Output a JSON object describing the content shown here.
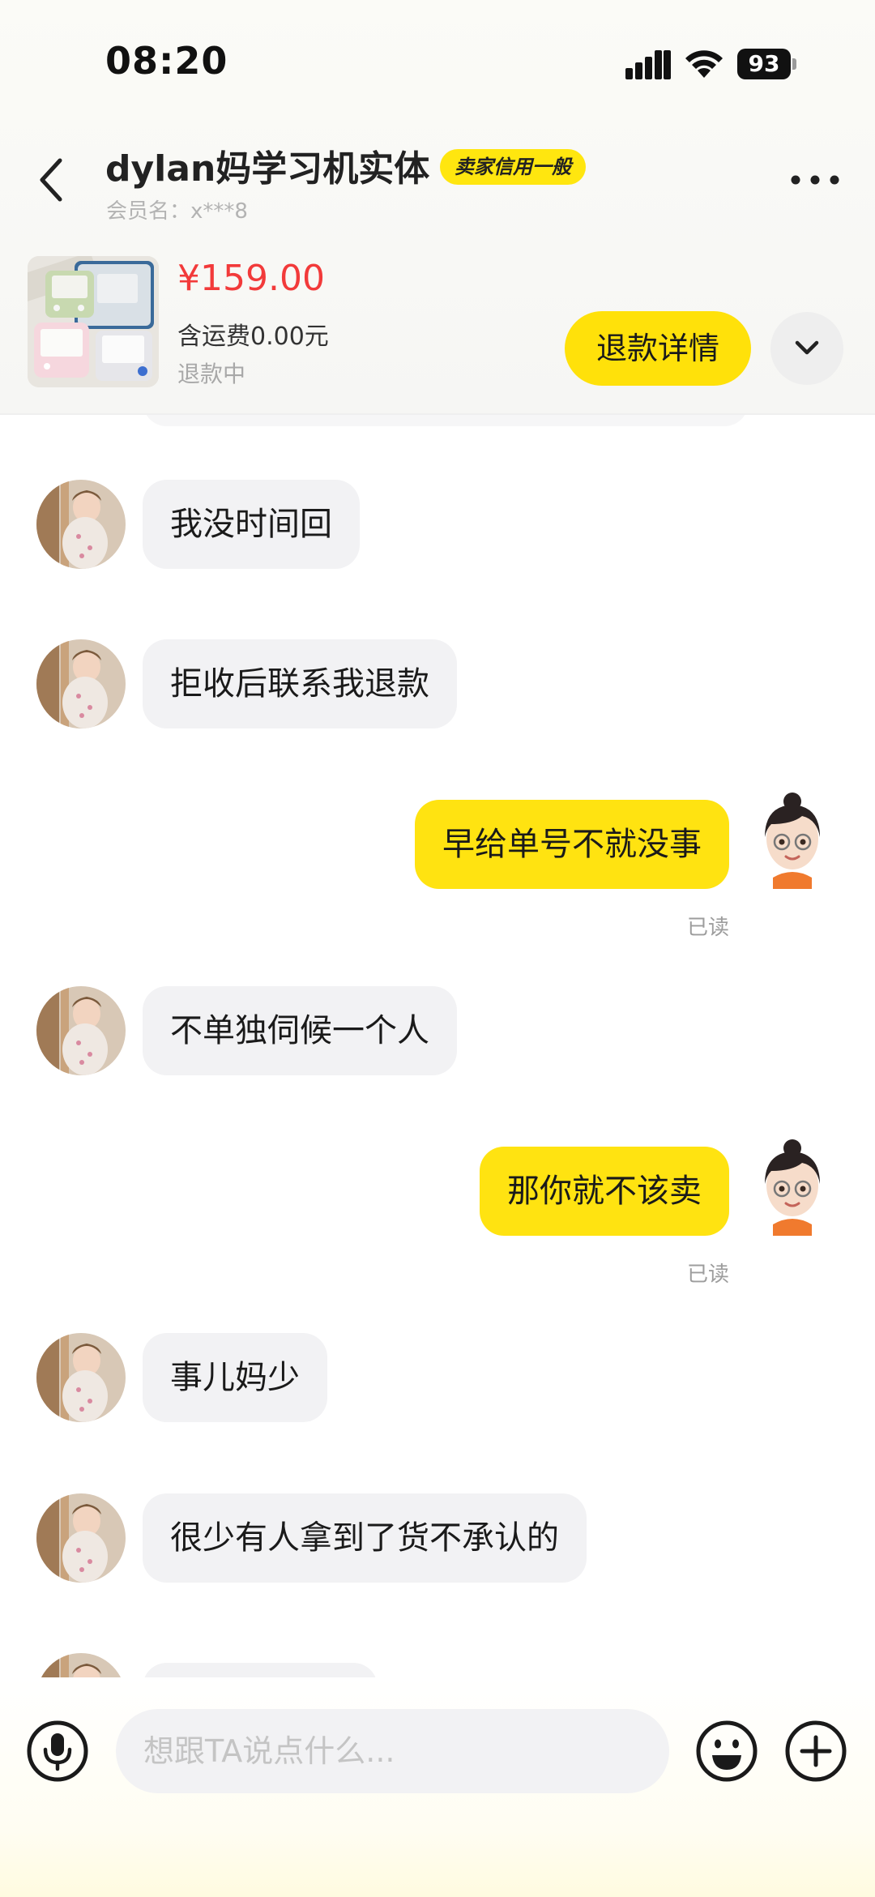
{
  "status_bar": {
    "time": "08:20",
    "battery": "93",
    "icons": [
      "signal-icon",
      "wifi-icon",
      "battery-icon"
    ]
  },
  "header": {
    "title": "dylan妈学习机实体",
    "badge": "卖家信用一般",
    "member": "会员名：x***8",
    "icons": [
      "back-icon",
      "more-icon"
    ]
  },
  "product": {
    "price": "¥159.00",
    "shipping": "含运费0.00元",
    "status": "退款中",
    "refund_button": "退款详情",
    "icons": [
      "chevron-down-icon"
    ]
  },
  "messages": [
    {
      "side": "in",
      "text": "我没时间回"
    },
    {
      "side": "in",
      "text": "拒收后联系我退款"
    },
    {
      "side": "out",
      "text": "早给单号不就没事",
      "read": "已读"
    },
    {
      "side": "in",
      "text": "不单独伺候一个人"
    },
    {
      "side": "out",
      "text": "那你就不该卖",
      "read": "已读"
    },
    {
      "side": "in",
      "text": "事儿妈少"
    },
    {
      "side": "in",
      "text": "很少有人拿到了货不承认的"
    }
  ],
  "input_bar": {
    "placeholder": "想跟TA说点什么...",
    "icons": [
      "microphone-icon",
      "emoji-icon",
      "plus-icon"
    ]
  },
  "colors": {
    "accent_yellow": "#ffe311",
    "price_red": "#f23a3a",
    "incoming_bubble": "#f2f2f4"
  }
}
